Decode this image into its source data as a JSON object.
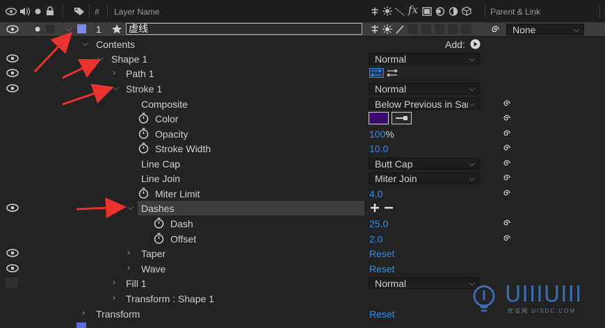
{
  "header": {
    "layer_name_label": "Layer Name",
    "number_label": "#",
    "parent_link_label": "Parent & Link",
    "switch_fx": "fx"
  },
  "layer": {
    "number": "1",
    "name": "虚线",
    "parent_value": "None",
    "label_color": "#7b87e8"
  },
  "tree": {
    "contents": "Contents",
    "add_label": "Add:",
    "shape1": "Shape 1",
    "shape1_blend": "Normal",
    "path1": "Path 1",
    "stroke1": "Stroke 1",
    "stroke1_blend": "Normal",
    "composite": "Composite",
    "composite_value": "Below Previous in Sar",
    "color": "Color",
    "color_swatch": "#3a0a6e",
    "opacity": "Opacity",
    "opacity_value": "100",
    "opacity_unit": "%",
    "stroke_width": "Stroke Width",
    "stroke_width_value": "10.0",
    "line_cap": "Line Cap",
    "line_cap_value": "Butt Cap",
    "line_join": "Line Join",
    "line_join_value": "Miter Join",
    "miter_limit": "Miter Limit",
    "miter_limit_value": "4.0",
    "dashes": "Dashes",
    "dash": "Dash",
    "dash_value": "25.0",
    "offset": "Offset",
    "offset_value": "2.0",
    "taper": "Taper",
    "taper_value": "Reset",
    "wave": "Wave",
    "wave_value": "Reset",
    "fill1": "Fill 1",
    "fill1_blend": "Normal",
    "transform_shape1": "Transform : Shape 1",
    "transform": "Transform",
    "transform_value": "Reset"
  },
  "watermark": {
    "logo_text": "UIIIUIII",
    "sub_text": "优设网 UISDC.COM"
  },
  "colors": {
    "value_blue": "#2d8ceb",
    "arrow_red": "#e8322b",
    "selected_row": "#3d3d3d"
  }
}
